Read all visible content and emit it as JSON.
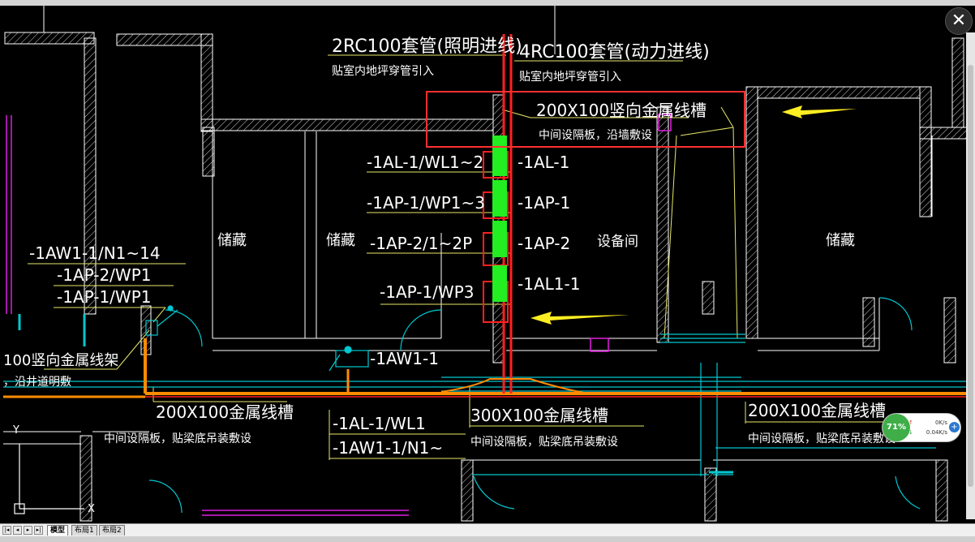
{
  "labels": {
    "rc_light": "2RC100套管(照明进线)",
    "rc_light_sub": "贴室内地坪穿管引入",
    "rc_power": "4RC100套管(动力进线)",
    "rc_power_sub": "贴室内地坪穿管引入",
    "vertical_trough": "200X100竖向金属线槽",
    "vertical_trough_sub": "中间设隔板，沿墙敷设",
    "lead_al1": "-1AL-1/WL1~2",
    "lead_ap1": "-1AP-1/WP1~3",
    "lead_ap2": "-1AP-2/1~2P",
    "lead_ap1_wp3": "-1AP-1/WP3",
    "panel_al1": "-1AL-1",
    "panel_ap1": "-1AP-1",
    "panel_ap2": "-1AP-2",
    "panel_al11": "-1AL1-1",
    "equipment_room": "设备间",
    "storage_1": "储藏",
    "storage_2": "储藏",
    "storage_3": "储藏",
    "left_aw1": "-1AW1-1/N1~14",
    "left_ap2": "-1AP-2/WP1",
    "left_ap1": "-1AP-1/WP1",
    "left_vertical": "100竖向金属线架",
    "left_vertical_sub": "，沿井道明敷",
    "aw1": "-1AW1-1",
    "trough_left": "200X100金属线槽",
    "trough_left_sub": "中间设隔板，贴梁底吊装敷设",
    "bottom_al1": "-1AL-1/WL1",
    "bottom_aw1": "-1AW1-1/N1~",
    "trough_mid": "300X100金属线槽",
    "trough_mid_sub": "中间设隔板，贴梁底吊装敷设",
    "trough_right": "200X100金属线槽",
    "trough_right_sub": "中间设隔板，贴梁底吊装敷设",
    "axis_y": "Y",
    "axis_x": "X"
  },
  "tabs": {
    "model": "模型",
    "layout1": "布局1",
    "layout2": "布局2"
  },
  "nav": {
    "first": "|◂",
    "prev": "◂",
    "next": "▸",
    "last": "▸|"
  },
  "close_glyph": "✕",
  "network": {
    "percent": "71%",
    "upload": "0K/s",
    "download": "0.04K/s",
    "up_arrow": "↑",
    "down_arrow": "↓",
    "plus": "+"
  },
  "colors": {
    "background": "#000000",
    "wall": "#ffffff",
    "label": "#ffffff",
    "leader": "#e8e86a",
    "cyan": "#00c8d0",
    "red": "#ff2020",
    "orange": "#ff8c00",
    "green": "#22ee22",
    "magenta": "#e020e0",
    "highlight_box": "#ff3030",
    "arrow": "#ffee22"
  }
}
